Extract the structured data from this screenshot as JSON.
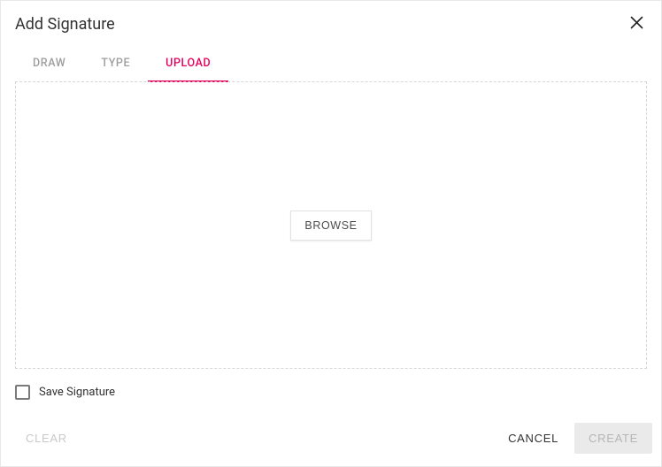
{
  "dialog": {
    "title": "Add Signature"
  },
  "tabs": {
    "draw": "DRAW",
    "type": "TYPE",
    "upload": "UPLOAD"
  },
  "browse_label": "BROWSE",
  "save_checkbox_label": "Save Signature",
  "footer": {
    "clear": "CLEAR",
    "cancel": "CANCEL",
    "create": "CREATE"
  }
}
